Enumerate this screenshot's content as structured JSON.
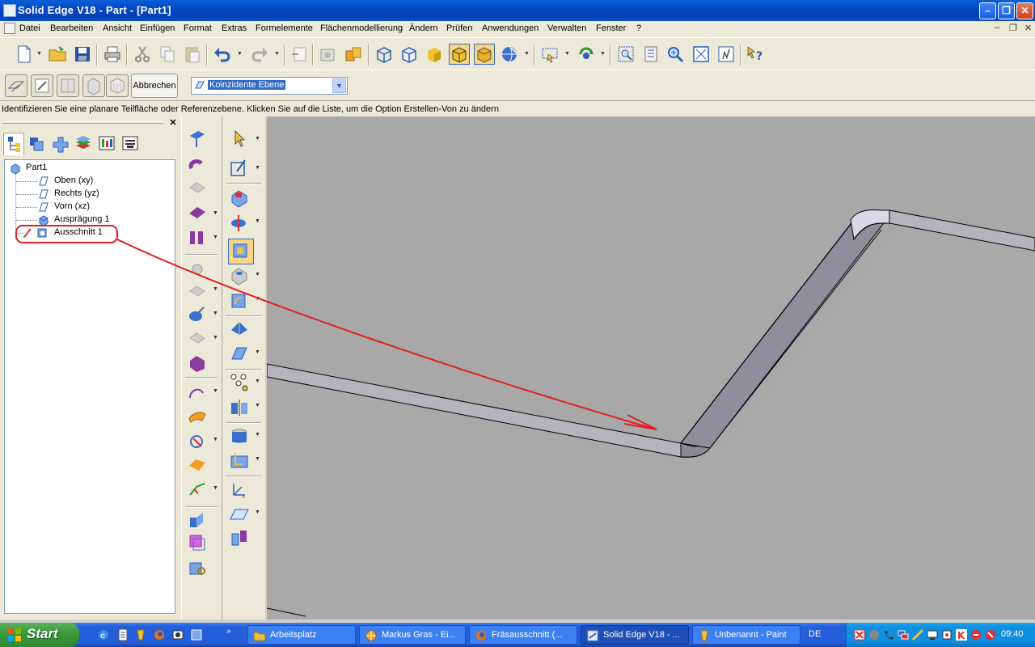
{
  "window": {
    "title": "Solid Edge V18 - Part - [Part1]"
  },
  "menu": [
    "Datei",
    "Bearbeiten",
    "Ansicht",
    "Einfügen",
    "Format",
    "Extras",
    "Formelemente",
    "Flächenmodellierung",
    "Ändern",
    "Prüfen",
    "Anwendungen",
    "Verwalten",
    "Fenster",
    "?"
  ],
  "command_bar": {
    "cancel_label": "Abbrechen",
    "plane_option": "Koinzidente Ebene"
  },
  "prompt": "Identifizieren Sie eine planare Teilfläche oder Referenzebene. Klicken Sie auf die Liste, um die Option Erstellen-Von zu ändern",
  "tree": {
    "root": "Part1",
    "items": [
      "Oben (xy)",
      "Rechts (yz)",
      "Vorn (xz)",
      "Ausprägung 1",
      "Ausschnitt 1"
    ]
  },
  "taskbar": {
    "start": "Start",
    "tasks": [
      "Arbeitsplatz",
      "Markus Gras - Ei...",
      "Fräsausschnitt (...",
      "Solid Edge V18 - ...",
      "Unbenannt - Paint"
    ],
    "language": "DE",
    "clock": "09:40"
  },
  "colors": {
    "annotation": "#e02020",
    "viewport": "#a9a9a9",
    "title_bar": "#0a5fd8"
  }
}
